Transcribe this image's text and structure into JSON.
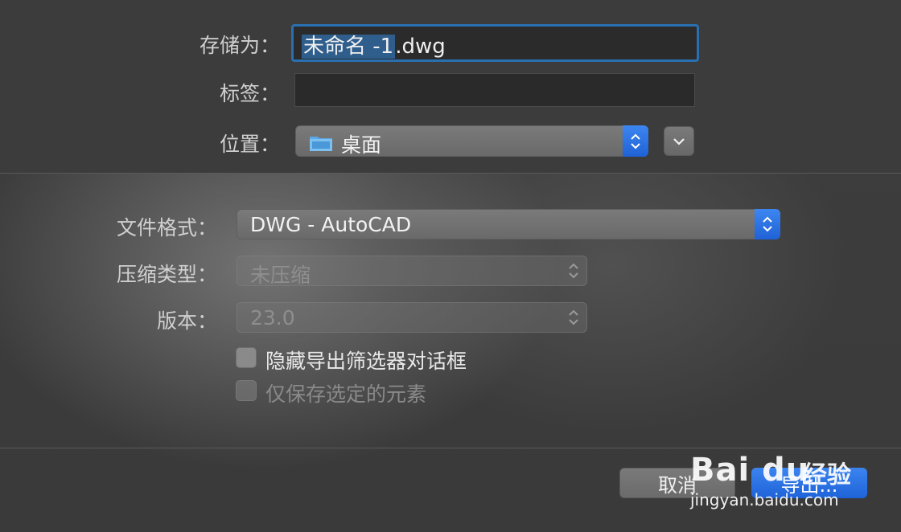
{
  "save_as": {
    "label": "存储为：",
    "value_selected": "未命名 -1",
    "value_rest": ".dwg"
  },
  "tags": {
    "label": "标签：",
    "value": ""
  },
  "location": {
    "label": "位置：",
    "value": "桌面",
    "icon": "folder-icon"
  },
  "file_format": {
    "label": "文件格式：",
    "value": "DWG - AutoCAD"
  },
  "compression": {
    "label": "压缩类型：",
    "value": "未压缩"
  },
  "version": {
    "label": "版本：",
    "value": "23.0"
  },
  "options": [
    {
      "label": "隐藏导出筛选器对话框",
      "checked": false,
      "enabled": true
    },
    {
      "label": "仅保存选定的元素",
      "checked": false,
      "enabled": false
    }
  ],
  "buttons": {
    "cancel": "取消",
    "export": "导出..."
  },
  "watermark": {
    "logo": "Bai du",
    "jingyan": "经验",
    "url": "jingyan.baidu.com"
  },
  "colors": {
    "accent": "#2a6fb0",
    "primary_button": "#1f63d8"
  }
}
